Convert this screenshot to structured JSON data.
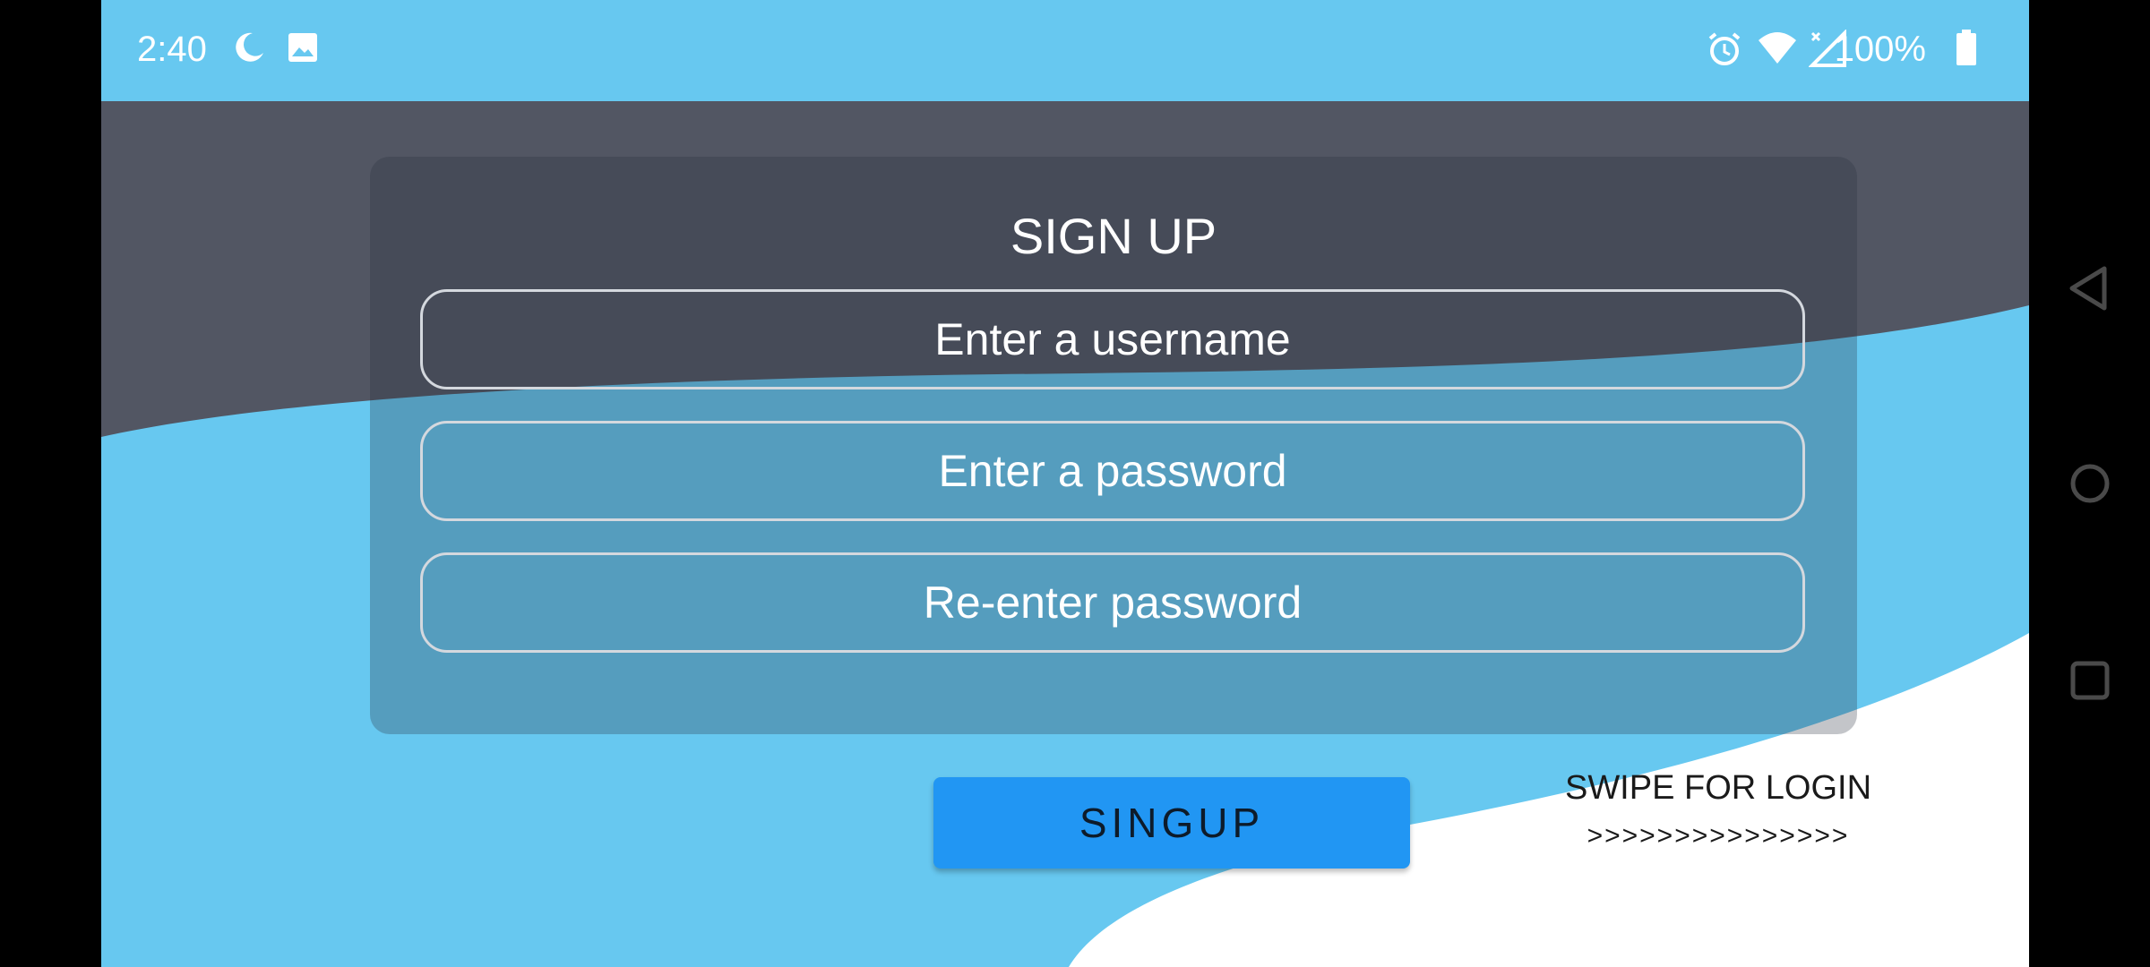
{
  "status_bar": {
    "time": "2:40",
    "battery_text": "100%",
    "icons": [
      "moon-icon",
      "image-icon",
      "alarm-icon",
      "wifi-icon",
      "signal-icon",
      "battery-icon"
    ]
  },
  "form": {
    "title": "SIGN UP",
    "username_placeholder": "Enter a username",
    "password_placeholder": "Enter a password",
    "reenter_placeholder": "Re-enter password",
    "signup_button": "SINGUP"
  },
  "swipe_hint": {
    "title": "SWIPE FOR LOGIN",
    "arrows": ">>>>>>>>>>>>>>>"
  },
  "nav_bar": {
    "icons": [
      "back-icon",
      "home-icon",
      "recents-icon"
    ]
  },
  "colors": {
    "sky_blue": "#67C8F0",
    "dark_slate": "#525663",
    "button_blue": "#2196F3",
    "white": "#FFFFFF"
  }
}
